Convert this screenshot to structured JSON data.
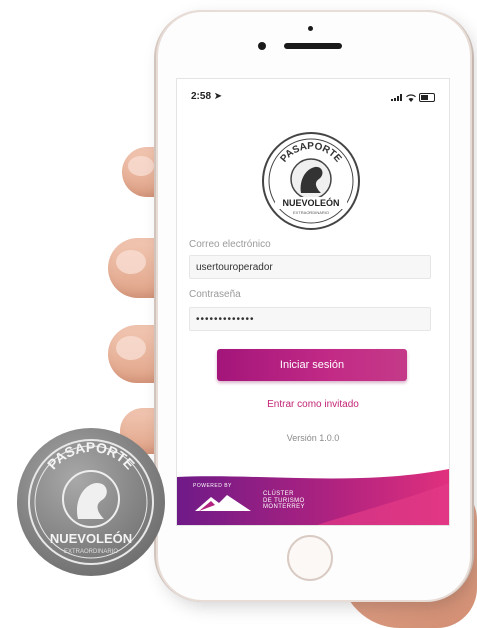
{
  "status_bar": {
    "time": "2:58"
  },
  "logo": {
    "top_text": "PASAPORTE",
    "bottom_text": "NUEVOLEÓN",
    "sub_text": "EXTRAORDINARIO"
  },
  "login": {
    "email_label": "Correo electrónico",
    "email_value": "usertouroperador",
    "password_label": "Contraseña",
    "password_value": "•••••••••••••",
    "submit_label": "Iniciar sesión",
    "guest_link": "Entrar como invitado",
    "version": "Versión 1.0.0"
  },
  "footer": {
    "powered_by": "POWERED BY",
    "cluster_lines": [
      "CLÚSTER",
      "DE TURISMO",
      "MONTERREY"
    ]
  },
  "stamp": {
    "top_text": "PASAPORTE",
    "bottom_text": "NUEVOLEÓN",
    "sub_text": "EXTRAORDINARIO"
  },
  "colors": {
    "accent": "#b41f7e",
    "link": "#c22474",
    "footer_start": "#7a1a8a",
    "footer_end": "#e0307e"
  }
}
